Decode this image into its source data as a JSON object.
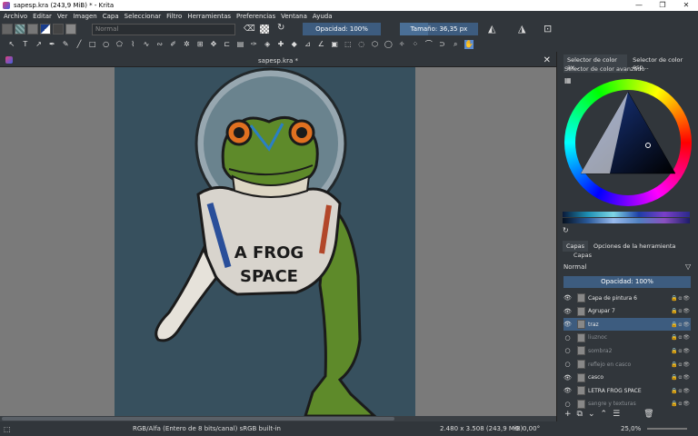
{
  "window": {
    "title": "sapesp.kra (243,9 MiB)  * - Krita",
    "minimize": "—",
    "maximize": "❐",
    "close": "✕"
  },
  "menu": [
    "Archivo",
    "Editar",
    "Ver",
    "Imagen",
    "Capa",
    "Seleccionar",
    "Filtro",
    "Herramientas",
    "Preferencias",
    "Ventana",
    "Ayuda"
  ],
  "toolbar": {
    "blend_mode": "Normal",
    "opacity_label": "Opacidad: 100%",
    "size_label": "Tamaño: 36,35 px",
    "size_fraction": 0.36
  },
  "canvas": {
    "doc_title": "sapesp.kra *",
    "close": "✕",
    "art_text_line1": "A FROG",
    "art_text_line2": "SPACE"
  },
  "dock": {
    "tab_color_adv": "Selector de color av...",
    "tab_color_spec": "Selector de color esp...",
    "color_panel_title": "Selector de color avanzado",
    "tab_layers": "Capas",
    "tab_tool_options": "Opciones de la herramienta",
    "layers_title": "Capas",
    "blend_mode": "Normal",
    "opacity_label": "Opacidad:  100%"
  },
  "layers": [
    {
      "name": "Capa de pintura 6",
      "visible": true,
      "selected": false,
      "dim": false
    },
    {
      "name": "Agrupar 7",
      "visible": true,
      "selected": false,
      "dim": false
    },
    {
      "name": "traz",
      "visible": true,
      "selected": true,
      "dim": false
    },
    {
      "name": "liuznoc",
      "visible": false,
      "selected": false,
      "dim": true
    },
    {
      "name": "sombra2",
      "visible": false,
      "selected": false,
      "dim": true
    },
    {
      "name": "reflejo en casco",
      "visible": false,
      "selected": false,
      "dim": true
    },
    {
      "name": "casco",
      "visible": true,
      "selected": false,
      "dim": false
    },
    {
      "name": "LETRA FROG SPACE",
      "visible": true,
      "selected": false,
      "dim": false
    },
    {
      "name": "sangre y texturas",
      "visible": false,
      "selected": false,
      "dim": true
    }
  ],
  "status": {
    "color_model": "RGB/Alfa (Entero de 8 bits/canal)  sRGB built-in",
    "dimensions": "2.480 x 3.508 (243,9 MiB)",
    "rotation": "0,00°",
    "zoom": "25,0%"
  },
  "colors": {
    "accent": "#3d5c7f",
    "bg": "#31363b",
    "frog": "#5e8a2a"
  }
}
